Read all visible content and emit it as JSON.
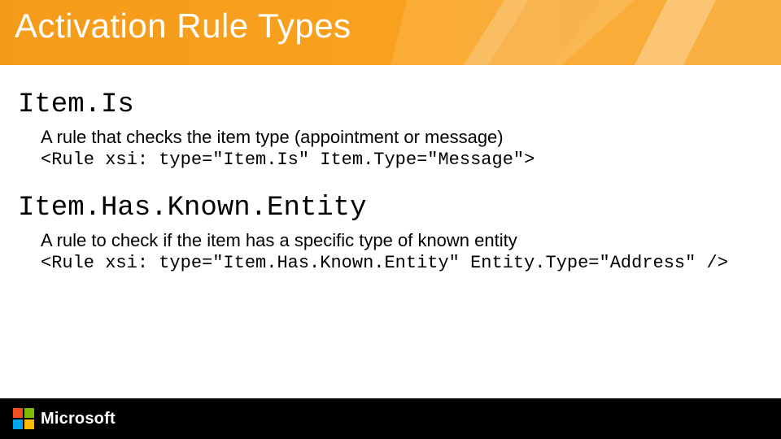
{
  "header": {
    "title": "Activation Rule Types"
  },
  "rules": [
    {
      "name": "Item.Is",
      "desc": "A rule that checks the item type (appointment or message)",
      "code": "<Rule xsi: type=\"Item.Is\" Item.Type=\"Message\">"
    },
    {
      "name": "Item.Has.Known.Entity",
      "desc": "A rule to check if the item has a specific type of known entity",
      "code": "<Rule xsi: type=\"Item.Has.Known.Entity\" Entity.Type=\"Address\" />"
    }
  ],
  "footer": {
    "brand": "Microsoft"
  }
}
